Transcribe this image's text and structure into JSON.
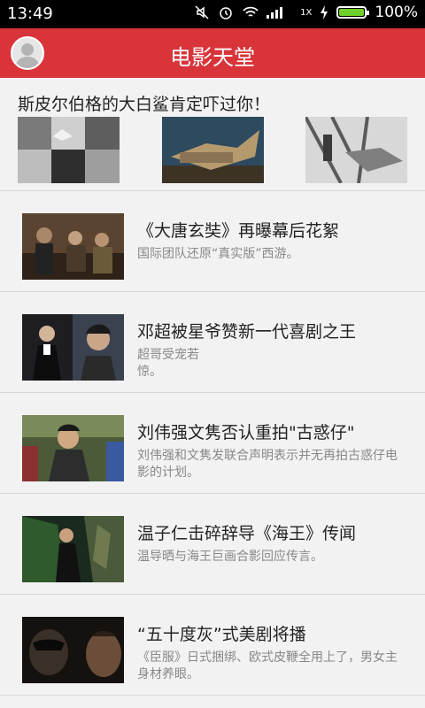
{
  "status": {
    "time": "13:49",
    "battery_text": "100%",
    "battery_level": 1.0,
    "network_label": "1X"
  },
  "header": {
    "title": "电影天堂"
  },
  "featured": {
    "title": "斯皮尔伯格的大白鲨肯定吓过你！"
  },
  "news": [
    {
      "title": "《大唐玄奘》再曝幕后花絮",
      "summary": "国际团队还原“真实版”西游。"
    },
    {
      "title": "邓超被星爷赞新一代喜剧之王",
      "summary": "超哥受宠若惊。"
    },
    {
      "title": "刘伟强文隽否认重拍\"古惑仔\"",
      "summary": "刘伟强和文隽发联合声明表示并无再拍古惑仔电影的计划。"
    },
    {
      "title": "温子仁击碎辞导《海王》传闻",
      "summary": "温导晒与海王巨画合影回应传言。"
    },
    {
      "title": "“五十度灰”式美剧将播",
      "summary": "《臣服》日式捆绑、欧式皮鞭全用上了，男女主身材养眼。"
    }
  ]
}
